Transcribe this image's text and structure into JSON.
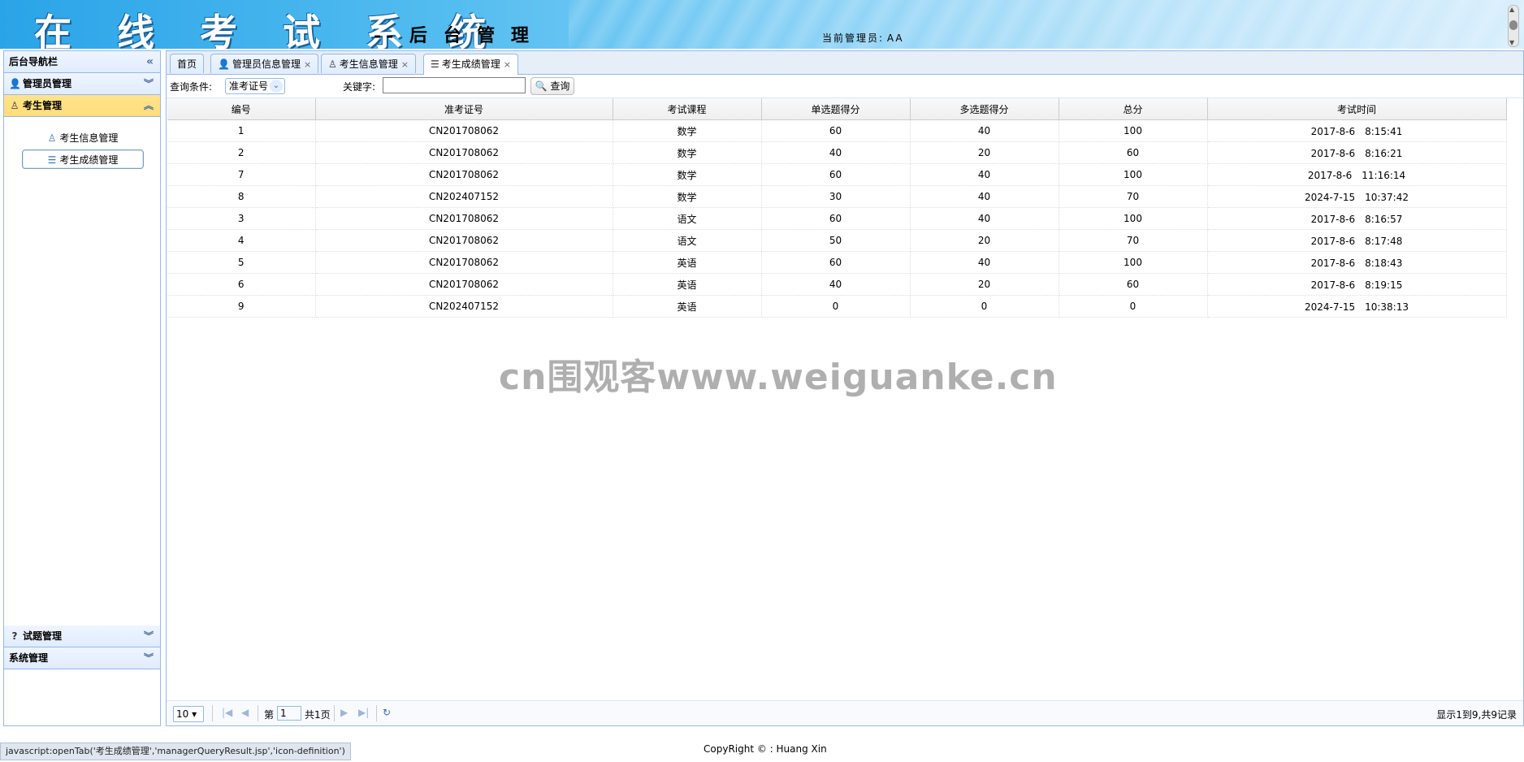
{
  "banner": {
    "title": "在 线 考 试 系 统",
    "subtitle": "-- 后 台 管 理",
    "admin_label": "当前管理员:",
    "admin_name": "AA"
  },
  "nav": {
    "header": "后台导航栏",
    "sections": [
      {
        "label": "管理员管理",
        "icon": "user-icon"
      },
      {
        "label": "考生管理",
        "icon": "students-icon",
        "active": true,
        "items": [
          {
            "label": "考生信息管理",
            "icon": "students-icon"
          },
          {
            "label": "考生成绩管理",
            "icon": "definition-icon",
            "selected": true
          }
        ]
      },
      {
        "label": "试题管理",
        "icon": "help-icon"
      },
      {
        "label": "系统管理",
        "icon": ""
      }
    ]
  },
  "tabs": [
    {
      "label": "首页"
    },
    {
      "label": "管理员信息管理",
      "icon": "user-icon"
    },
    {
      "label": "考生信息管理",
      "icon": "students-icon"
    },
    {
      "label": "考生成绩管理",
      "icon": "definition-icon",
      "active": true
    }
  ],
  "toolbar": {
    "query_condition_label": "查询条件:",
    "query_field_selected": "准考证号",
    "keyword_label": "关键字:",
    "keyword_value": "",
    "query_button": "查询"
  },
  "table": {
    "columns": [
      "编号",
      "准考证号",
      "考试课程",
      "单选题得分",
      "多选题得分",
      "总分",
      "考试时间"
    ],
    "rows": [
      [
        "1",
        "CN201708062",
        "数学",
        "60",
        "40",
        "100",
        "2017-8-6　8:15:41"
      ],
      [
        "2",
        "CN201708062",
        "数学",
        "40",
        "20",
        "60",
        "2017-8-6　8:16:21"
      ],
      [
        "7",
        "CN201708062",
        "数学",
        "60",
        "40",
        "100",
        "2017-8-6　11:16:14"
      ],
      [
        "8",
        "CN202407152",
        "数学",
        "30",
        "40",
        "70",
        "2024-7-15　10:37:42"
      ],
      [
        "3",
        "CN201708062",
        "语文",
        "60",
        "40",
        "100",
        "2017-8-6　8:16:57"
      ],
      [
        "4",
        "CN201708062",
        "语文",
        "50",
        "20",
        "70",
        "2017-8-6　8:17:48"
      ],
      [
        "5",
        "CN201708062",
        "英语",
        "60",
        "40",
        "100",
        "2017-8-6　8:18:43"
      ],
      [
        "6",
        "CN201708062",
        "英语",
        "40",
        "20",
        "60",
        "2017-8-6　8:19:15"
      ],
      [
        "9",
        "CN202407152",
        "英语",
        "0",
        "0",
        "0",
        "2024-7-15　10:38:13"
      ]
    ]
  },
  "pager": {
    "page_size": "10",
    "page_prefix": "第",
    "page_value": "1",
    "page_total": "共1页",
    "info": "显示1到9,共9记录"
  },
  "status_bar": "javascript:openTab('考生成绩管理','managerQueryResult.jsp','icon-definition')",
  "copyright": "CopyRight © : Huang Xin",
  "watermark": "cn围观客www.weiguanke.cn",
  "colors": {
    "border": "#95b8e7",
    "active_section": "#ffe48d",
    "header_bg": "#e0ecff"
  }
}
